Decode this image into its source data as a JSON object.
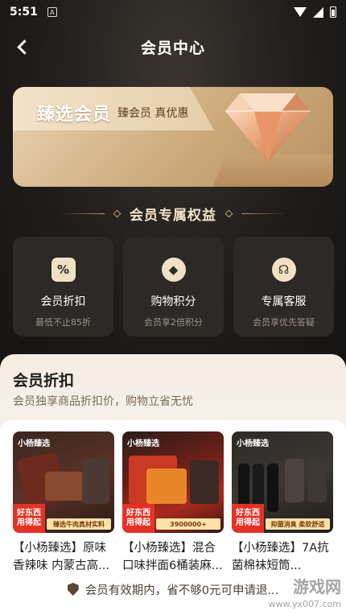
{
  "status_bar": {
    "time": "5:51",
    "badge": "A"
  },
  "nav": {
    "title": "会员中心"
  },
  "member_card": {
    "brand": "臻选会员",
    "slogan": "臻会员 真优惠"
  },
  "benefits": {
    "title": "会员专属权益",
    "items": [
      {
        "name": "会员折扣",
        "desc": "最低不止85折",
        "icon": "percent-badge-icon",
        "glyph": "%"
      },
      {
        "name": "购物积分",
        "desc": "会员享2倍积分",
        "icon": "diamond-coin-icon",
        "glyph": "◆"
      },
      {
        "name": "专属客服",
        "desc": "会员享优先答疑",
        "icon": "headset-icon",
        "glyph": "☊"
      }
    ]
  },
  "discount_section": {
    "title": "会员折扣",
    "subtitle": "会员独享商品折扣价，购物立省无忧"
  },
  "products": [
    {
      "name": "【小杨臻选】原味香辣味 内蒙古高...",
      "brand": "小杨臻选",
      "tag_line1": "好东西",
      "tag_line2": "用得起",
      "strip": "臻选牛肉真材实料"
    },
    {
      "name": "【小杨臻选】混合口味拌面6桶装麻...",
      "brand": "小杨臻选",
      "tag_line1": "好东西",
      "tag_line2": "用得起",
      "strip": "3900000+"
    },
    {
      "name": "【小杨臻选】7A抗菌棉袜短筒...",
      "brand": "小杨臻选",
      "tag_line1": "好东西",
      "tag_line2": "用得起",
      "strip": "抑菌消臭 柔软舒适"
    }
  ],
  "notice": {
    "text": "会员有效期内，省不够0元可申请退...",
    "watermark": "游戏网",
    "watermark_url": "www.yx007.com"
  },
  "colors": {
    "accent_gold": "#f1e1c4",
    "card_gold": "#d8b98e",
    "tile_bg": "#2c2926",
    "tag_red": "#e53227"
  }
}
